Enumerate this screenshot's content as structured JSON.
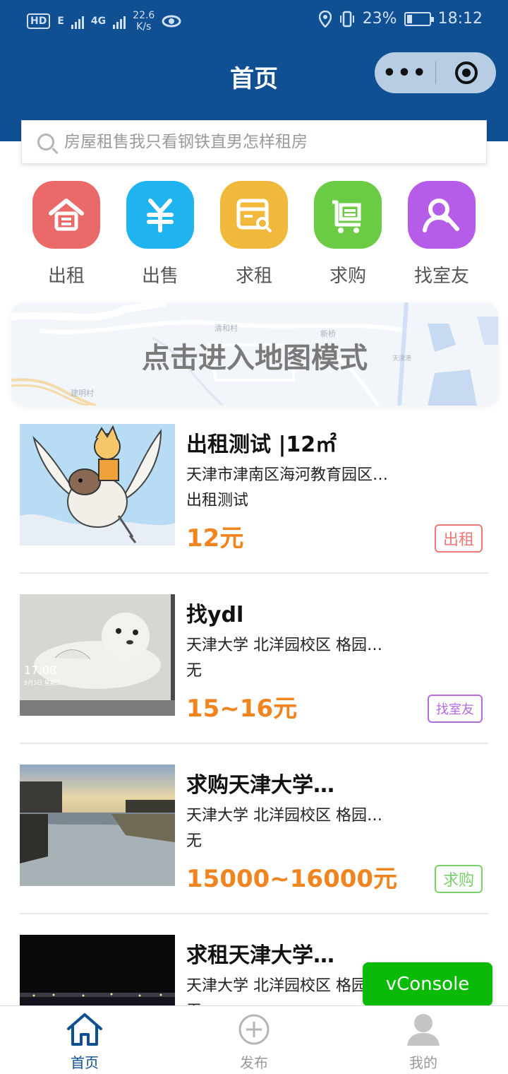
{
  "status_bar": {
    "hd": "HD",
    "net_left": "E",
    "net_right": "4G",
    "speed_value": "22.6",
    "speed_unit": "K/s",
    "battery": "23%",
    "time": "18:12",
    "battery_level": 0.23
  },
  "header": {
    "title": "首页",
    "menu_dots": "•••"
  },
  "search": {
    "placeholder": "房屋租售我只看钢铁直男怎样租房"
  },
  "categories": [
    {
      "label": "出租",
      "color": "#ea6a6a",
      "icon": "house-icon"
    },
    {
      "label": "出售",
      "color": "#1fb4ef",
      "icon": "yuan-icon"
    },
    {
      "label": "求租",
      "color": "#f0b93c",
      "icon": "browser-search-icon"
    },
    {
      "label": "求购",
      "color": "#6ccb45",
      "icon": "cart-icon"
    },
    {
      "label": "找室友",
      "color": "#b55de8",
      "icon": "roommate-search-icon"
    }
  ],
  "map_banner": {
    "text": "点击进入地图模式",
    "places": [
      "清和村",
      "新桥",
      "建明村",
      "天津港"
    ]
  },
  "listings": [
    {
      "title": "出租测试 |12㎡",
      "address": "天津市津南区海河教育园区…",
      "desc": "出租测试",
      "price": "12元",
      "tag": "出租",
      "tag_color": "#ee7777"
    },
    {
      "title": "找ydl",
      "address": "天津大学 北洋园校区 格园…",
      "desc": "无",
      "price": "15~16元",
      "tag": "找室友",
      "tag_color": "#b46be0"
    },
    {
      "title": "求购天津大学…",
      "address": "天津大学 北洋园校区 格园…",
      "desc": "无",
      "price": "15000~16000元",
      "tag": "求购",
      "tag_color": "#7bcf6a"
    },
    {
      "title": "求租天津大学…",
      "address": "天津大学 北洋园校区 格园…",
      "desc": "无",
      "price": "",
      "tag": "",
      "tag_color": "#f0b93c"
    }
  ],
  "thumb_texts": {
    "clock": "17:08",
    "date": "9月3日 星期二"
  },
  "vconsole": "vConsole",
  "tabbar": [
    {
      "label": "首页",
      "active": true
    },
    {
      "label": "发布",
      "active": false
    },
    {
      "label": "我的",
      "active": false
    }
  ],
  "colors": {
    "header": "#0f4f92",
    "price": "#f0841f",
    "tab_active": "#0f4f92",
    "tab_inactive": "#999999"
  }
}
